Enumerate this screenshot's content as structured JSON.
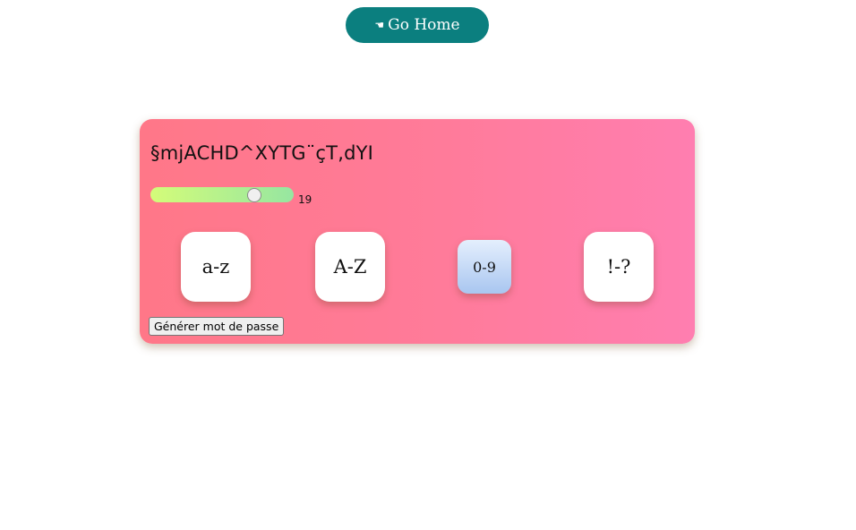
{
  "home_button": {
    "icon": "pointing-hand-icon",
    "icon_glyph": "☚",
    "label": "Go Home"
  },
  "generator": {
    "password": "§mjACHD^XYTG¨çT,dYI",
    "length": {
      "value": "19",
      "level": 0.75
    },
    "options": [
      {
        "label": "a-z",
        "selected": false
      },
      {
        "label": "A-Z",
        "selected": false
      },
      {
        "label": "0-9",
        "selected": true
      },
      {
        "label": "!-?",
        "selected": false
      }
    ],
    "generate_label": "Générer mot de passe"
  },
  "colors": {
    "home_button": "#0b7f7f",
    "card_gradient_start": "#ff7788",
    "card_gradient_end": "#ff7eb0",
    "slider_gradient_start": "#d4fc79",
    "slider_gradient_end": "#96e6a1",
    "selected_option_gradient_end": "#a9c6f0"
  }
}
